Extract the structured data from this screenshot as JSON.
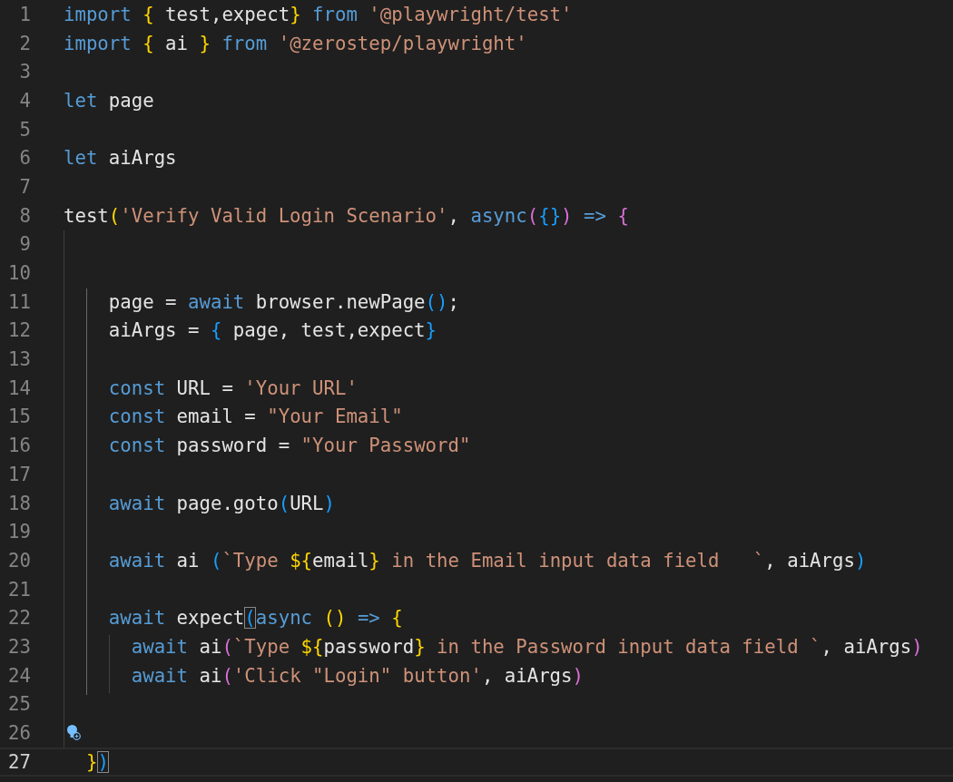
{
  "editor": {
    "lines": [
      {
        "number": "1",
        "current": false,
        "tokens": [
          {
            "kind": "keyword",
            "text": "import"
          },
          {
            "kind": "bracket-gold",
            "text": " {"
          },
          {
            "kind": "plain",
            "text": " test,expect"
          },
          {
            "kind": "bracket-gold",
            "text": "}"
          },
          {
            "kind": "keyword",
            "text": " from"
          },
          {
            "kind": "string",
            "text": " '@playwright/test'"
          }
        ]
      },
      {
        "number": "2",
        "current": false,
        "tokens": [
          {
            "kind": "keyword",
            "text": "import"
          },
          {
            "kind": "bracket-gold",
            "text": " {"
          },
          {
            "kind": "plain",
            "text": " ai "
          },
          {
            "kind": "bracket-gold",
            "text": "}"
          },
          {
            "kind": "keyword",
            "text": " from"
          },
          {
            "kind": "string",
            "text": " '@zerostep/playwright'"
          }
        ]
      },
      {
        "number": "3",
        "current": false
      },
      {
        "number": "4",
        "current": false,
        "tokens": [
          {
            "kind": "keyword",
            "text": "let"
          },
          {
            "kind": "plain",
            "text": " page"
          }
        ]
      },
      {
        "number": "5",
        "current": false
      },
      {
        "number": "6",
        "current": false,
        "tokens": [
          {
            "kind": "keyword",
            "text": "let"
          },
          {
            "kind": "plain",
            "text": " aiArgs"
          }
        ]
      },
      {
        "number": "7",
        "current": false
      },
      {
        "number": "8",
        "current": false,
        "tokens": [
          {
            "kind": "plain",
            "text": "test"
          },
          {
            "kind": "bracket-gold",
            "text": "("
          },
          {
            "kind": "string",
            "text": "'Verify Valid Login Scenario'"
          },
          {
            "kind": "plain",
            "text": ","
          },
          {
            "kind": "keyword",
            "text": " async"
          },
          {
            "kind": "bracket-pink",
            "text": "("
          },
          {
            "kind": "bracket-blue",
            "text": "{}"
          },
          {
            "kind": "bracket-pink",
            "text": ")"
          },
          {
            "kind": "keyword",
            "text": " =>"
          },
          {
            "kind": "bracket-pink",
            "text": " {"
          }
        ]
      },
      {
        "number": "9",
        "current": false
      },
      {
        "number": "10",
        "current": false
      },
      {
        "number": "11",
        "current": false,
        "tokens": [
          {
            "kind": "plain",
            "text": "    page = "
          },
          {
            "kind": "keyword",
            "text": "await"
          },
          {
            "kind": "plain",
            "text": " browser.newPage"
          },
          {
            "kind": "bracket-blue",
            "text": "()"
          },
          {
            "kind": "plain",
            "text": ";"
          }
        ]
      },
      {
        "number": "12",
        "current": false,
        "tokens": [
          {
            "kind": "plain",
            "text": "    aiArgs = "
          },
          {
            "kind": "bracket-blue",
            "text": "{"
          },
          {
            "kind": "plain",
            "text": " page, test,expect"
          },
          {
            "kind": "bracket-blue",
            "text": "}"
          }
        ]
      },
      {
        "number": "13",
        "current": false
      },
      {
        "number": "14",
        "current": false,
        "tokens": [
          {
            "kind": "keyword",
            "text": "    const"
          },
          {
            "kind": "plain",
            "text": " URL = "
          },
          {
            "kind": "string",
            "text": "'Your URL'"
          }
        ]
      },
      {
        "number": "15",
        "current": false,
        "tokens": [
          {
            "kind": "keyword",
            "text": "    const"
          },
          {
            "kind": "plain",
            "text": " email = "
          },
          {
            "kind": "string",
            "text": "\"Your Email\""
          }
        ]
      },
      {
        "number": "16",
        "current": false,
        "tokens": [
          {
            "kind": "keyword",
            "text": "    const"
          },
          {
            "kind": "plain",
            "text": " password = "
          },
          {
            "kind": "string",
            "text": "\"Your Password\""
          }
        ]
      },
      {
        "number": "17",
        "current": false
      },
      {
        "number": "18",
        "current": false,
        "tokens": [
          {
            "kind": "keyword",
            "text": "    await"
          },
          {
            "kind": "plain",
            "text": " page.goto"
          },
          {
            "kind": "bracket-blue",
            "text": "("
          },
          {
            "kind": "plain",
            "text": "URL"
          },
          {
            "kind": "bracket-blue",
            "text": ")"
          }
        ]
      },
      {
        "number": "19",
        "current": false
      },
      {
        "number": "20",
        "current": false,
        "tokens": [
          {
            "kind": "keyword",
            "text": "    await"
          },
          {
            "kind": "plain",
            "text": " ai "
          },
          {
            "kind": "bracket-blue",
            "text": "("
          },
          {
            "kind": "string",
            "text": "`Type "
          },
          {
            "kind": "bracket-gold",
            "text": "${"
          },
          {
            "kind": "plain",
            "text": "email"
          },
          {
            "kind": "bracket-gold",
            "text": "}"
          },
          {
            "kind": "string",
            "text": " in the Email input data field   `"
          },
          {
            "kind": "plain",
            "text": ", aiArgs"
          },
          {
            "kind": "bracket-blue",
            "text": ")"
          }
        ]
      },
      {
        "number": "21",
        "current": false
      },
      {
        "number": "22",
        "current": false,
        "tokens": [
          {
            "kind": "keyword",
            "text": "    await"
          },
          {
            "kind": "plain",
            "text": " expect"
          },
          {
            "kind": "bracket-blue",
            "text": "(",
            "matched": true
          },
          {
            "kind": "keyword",
            "text": "async"
          },
          {
            "kind": "bracket-gold",
            "text": " ()"
          },
          {
            "kind": "keyword",
            "text": " =>"
          },
          {
            "kind": "bracket-gold",
            "text": " {"
          }
        ]
      },
      {
        "number": "23",
        "current": false,
        "tokens": [
          {
            "kind": "keyword",
            "text": "      await"
          },
          {
            "kind": "plain",
            "text": " ai"
          },
          {
            "kind": "bracket-pink",
            "text": "("
          },
          {
            "kind": "string",
            "text": "`Type "
          },
          {
            "kind": "bracket-gold",
            "text": "${"
          },
          {
            "kind": "plain",
            "text": "password"
          },
          {
            "kind": "bracket-gold",
            "text": "}"
          },
          {
            "kind": "string",
            "text": " in the Password input data field `"
          },
          {
            "kind": "plain",
            "text": ", aiArgs"
          },
          {
            "kind": "bracket-pink",
            "text": ")"
          }
        ]
      },
      {
        "number": "24",
        "current": false,
        "tokens": [
          {
            "kind": "keyword",
            "text": "      await"
          },
          {
            "kind": "plain",
            "text": " ai"
          },
          {
            "kind": "bracket-pink",
            "text": "("
          },
          {
            "kind": "string",
            "text": "'Click \"Login\" button'"
          },
          {
            "kind": "plain",
            "text": ", aiArgs"
          },
          {
            "kind": "bracket-pink",
            "text": ")"
          }
        ]
      },
      {
        "number": "25",
        "current": false
      },
      {
        "number": "26",
        "current": false,
        "lightbulb": true
      },
      {
        "number": "27",
        "current": true,
        "tokens": [
          {
            "kind": "bracket-gold",
            "text": "  }"
          },
          {
            "kind": "bracket-blue",
            "text": ")",
            "matched": true
          }
        ]
      }
    ]
  }
}
